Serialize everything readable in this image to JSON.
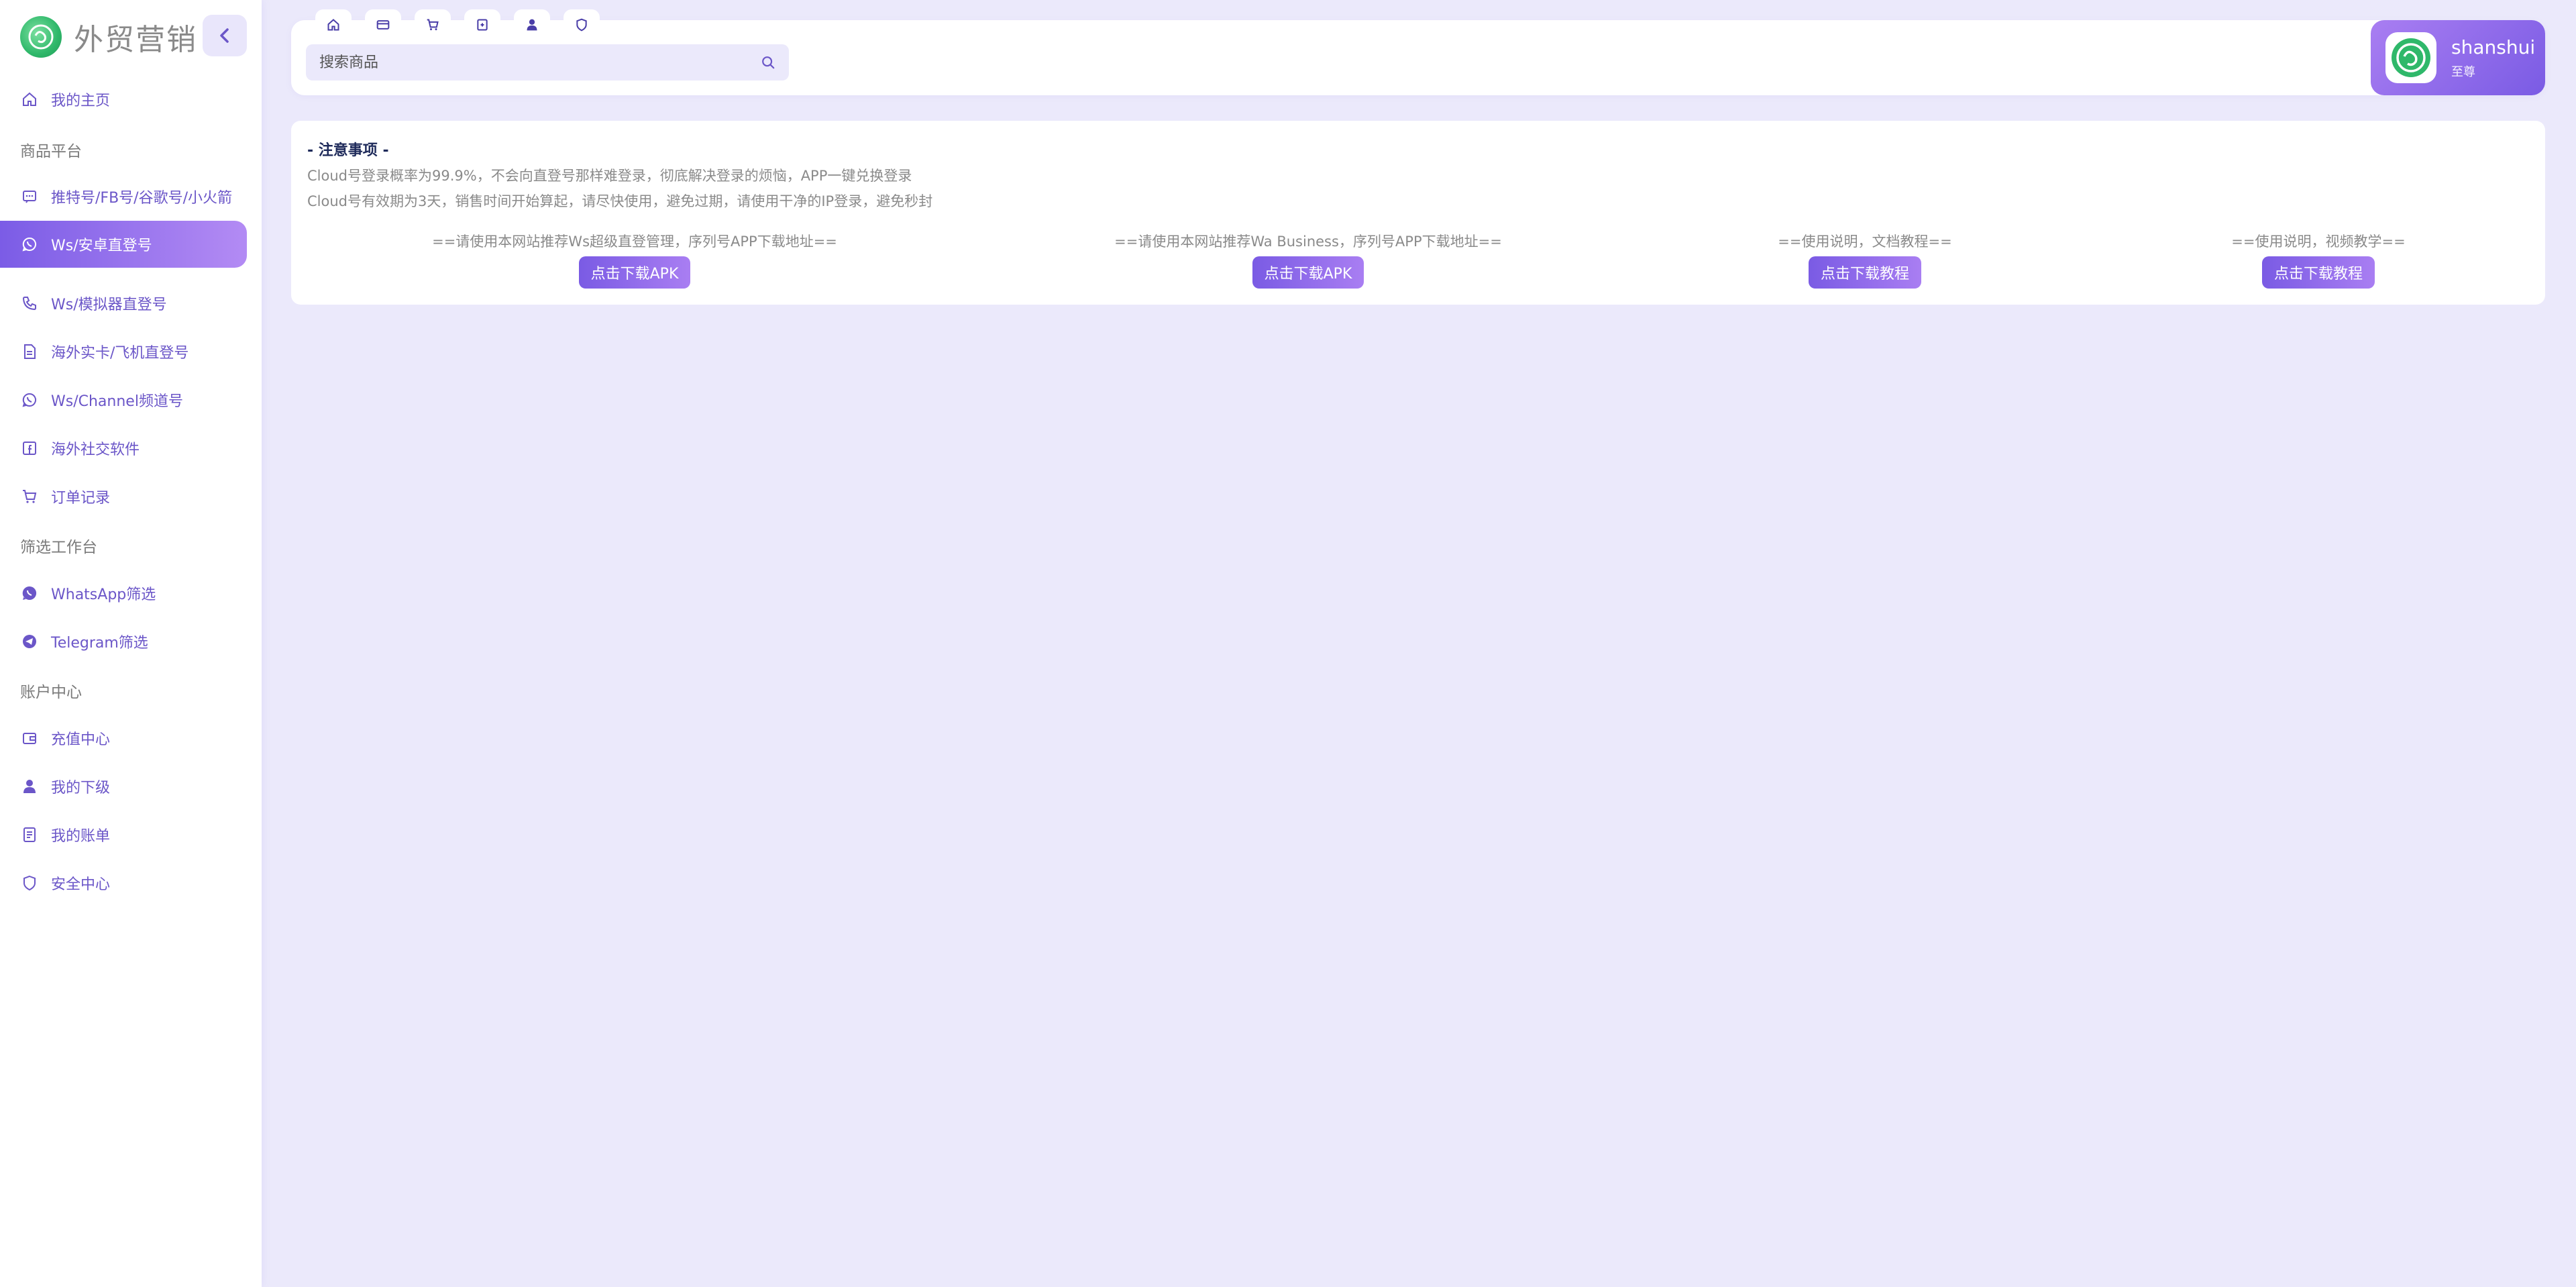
{
  "brand": {
    "title": "外贸营销"
  },
  "sidebar": {
    "items": [
      {
        "label": "我的主页",
        "icon": "home-icon"
      },
      {
        "group": "商品平台"
      },
      {
        "label": "推特号/FB号/谷歌号/小火箭",
        "icon": "message-icon"
      },
      {
        "label": "Ws/安卓直登号",
        "icon": "whatsapp-icon",
        "active": true
      },
      {
        "label": "Ws/模拟器直登号",
        "icon": "phone-icon"
      },
      {
        "label": "海外实卡/飞机直登号",
        "icon": "document-icon"
      },
      {
        "label": "Ws/Channel频道号",
        "icon": "whatsapp-icon"
      },
      {
        "label": "海外社交软件",
        "icon": "facebook-icon"
      },
      {
        "label": "订单记录",
        "icon": "cart-icon"
      },
      {
        "group": "筛选工作台"
      },
      {
        "label": "WhatsApp筛选",
        "icon": "whatsapp-filled-icon"
      },
      {
        "label": "Telegram筛选",
        "icon": "telegram-icon"
      },
      {
        "group": "账户中心"
      },
      {
        "label": "充值中心",
        "icon": "wallet-icon"
      },
      {
        "label": "我的下级",
        "icon": "user-icon"
      },
      {
        "label": "我的账单",
        "icon": "bill-icon"
      },
      {
        "label": "安全中心",
        "icon": "shield-icon"
      }
    ]
  },
  "header": {
    "tab_icons": [
      "home-icon",
      "card-icon",
      "cart-icon",
      "box-icon",
      "user-icon",
      "shield-icon"
    ],
    "search_placeholder": "搜索商品"
  },
  "user": {
    "name": "shanshui",
    "level": "至尊"
  },
  "notice": {
    "title": "- 注意事项 -",
    "lines": [
      "Cloud号登录概率为99.9%，不会向直登号那样难登录，彻底解决登录的烦恼，APP一键兑换登录",
      "Cloud号有效期为3天，销售时间开始算起，请尽快使用，避免过期，请使用干净的IP登录，避免秒封"
    ],
    "downloads": [
      {
        "caption": "==请使用本网站推荐Ws超级直登管理，序列号APP下载地址==",
        "button": "点击下载APK"
      },
      {
        "caption": "==请使用本网站推荐Wa Business，序列号APP下载地址==",
        "button": "点击下载APK"
      },
      {
        "caption": "==使用说明，文档教程==",
        "button": "点击下载教程"
      },
      {
        "caption": "==使用说明，视频教学==",
        "button": "点击下载教程"
      }
    ]
  },
  "colors": {
    "accent": "#7a5be4",
    "accent_light": "#a97ef2",
    "background": "#ebe9fb"
  }
}
